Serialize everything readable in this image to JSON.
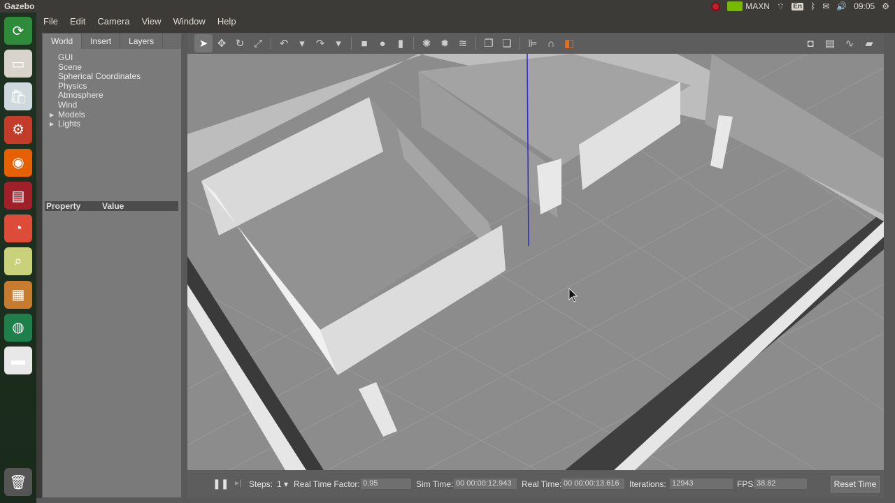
{
  "system": {
    "app_title": "Gazebo",
    "gpu_label": "MAXN",
    "lang": "En",
    "clock": "09:05"
  },
  "menu": [
    "File",
    "Edit",
    "Camera",
    "View",
    "Window",
    "Help"
  ],
  "launcher": [
    {
      "icon": "ubuntu-software-updater-icon",
      "color": "#2e8b3a",
      "glyph": "⟳"
    },
    {
      "icon": "files-icon",
      "color": "#d8d4cc",
      "glyph": "▭"
    },
    {
      "icon": "software-center-icon",
      "color": "#cfd8dc",
      "glyph": "🛍"
    },
    {
      "icon": "system-settings-icon",
      "color": "#c33c2a",
      "glyph": "⚙"
    },
    {
      "icon": "firefox-icon",
      "color": "#e66000",
      "glyph": "◉"
    },
    {
      "icon": "terminal-icon",
      "color": "#a0202a",
      "glyph": "▤"
    },
    {
      "icon": "chromium-icon",
      "color": "#dd4b39",
      "glyph": "◔"
    },
    {
      "icon": "image-viewer-icon",
      "color": "#c9d27a",
      "glyph": "⌕"
    },
    {
      "icon": "package-box-icon",
      "color": "#c77b2e",
      "glyph": "▦"
    },
    {
      "icon": "gazebo-globe-icon",
      "color": "#1e7f4a",
      "glyph": "◍"
    },
    {
      "icon": "drive-icon",
      "color": "#e8e8e8",
      "glyph": "▬"
    }
  ],
  "trash_icon": "trash-icon",
  "panel": {
    "tabs": [
      "World",
      "Insert",
      "Layers"
    ],
    "tree": [
      {
        "label": "GUI",
        "expandable": false
      },
      {
        "label": "Scene",
        "expandable": false
      },
      {
        "label": "Spherical Coordinates",
        "expandable": false
      },
      {
        "label": "Physics",
        "expandable": false
      },
      {
        "label": "Atmosphere",
        "expandable": false
      },
      {
        "label": "Wind",
        "expandable": false
      },
      {
        "label": "Models",
        "expandable": true
      },
      {
        "label": "Lights",
        "expandable": true
      }
    ],
    "property_col": "Property",
    "value_col": "Value"
  },
  "toolbar": {
    "tools": [
      {
        "name": "select-mode-icon",
        "glyph": "➤",
        "selected": true
      },
      {
        "name": "translate-mode-icon",
        "glyph": "✥"
      },
      {
        "name": "rotate-mode-icon",
        "glyph": "↻"
      },
      {
        "name": "scale-mode-icon",
        "glyph": "⤢"
      },
      {
        "sep": true
      },
      {
        "name": "undo-icon",
        "glyph": "↶"
      },
      {
        "name": "undo-dropdown-icon",
        "glyph": "▾"
      },
      {
        "name": "redo-icon",
        "glyph": "↷"
      },
      {
        "name": "redo-dropdown-icon",
        "glyph": "▾"
      },
      {
        "sep": true
      },
      {
        "name": "box-shape-icon",
        "glyph": "■"
      },
      {
        "name": "sphere-shape-icon",
        "glyph": "●"
      },
      {
        "name": "cylinder-shape-icon",
        "glyph": "▮"
      },
      {
        "sep": true
      },
      {
        "name": "point-light-icon",
        "glyph": "✺"
      },
      {
        "name": "spot-light-icon",
        "glyph": "✹"
      },
      {
        "name": "directional-light-icon",
        "glyph": "≋"
      },
      {
        "sep": true
      },
      {
        "name": "copy-icon",
        "glyph": "❐"
      },
      {
        "name": "paste-icon",
        "glyph": "❏"
      },
      {
        "sep": true
      },
      {
        "name": "align-icon",
        "glyph": "⊫"
      },
      {
        "name": "snap-icon",
        "glyph": "∩"
      },
      {
        "name": "change-view-icon",
        "glyph": "◧",
        "accent": "#e07020"
      }
    ],
    "right_tools": [
      {
        "name": "screenshot-icon",
        "glyph": "◘"
      },
      {
        "name": "log-icon",
        "glyph": "▤"
      },
      {
        "name": "plot-icon",
        "glyph": "∿"
      },
      {
        "name": "record-video-icon",
        "glyph": "▰"
      }
    ]
  },
  "status": {
    "steps_label": "Steps:",
    "steps_value": "1",
    "rtf_label": "Real Time Factor:",
    "rtf_value": "0.95",
    "sim_time_label": "Sim Time:",
    "sim_time_value": "00 00:00:12.943",
    "real_time_label": "Real Time:",
    "real_time_value": "00 00:00:13.616",
    "iterations_label": "Iterations:",
    "iterations_value": "12943",
    "fps_label": "FPS:",
    "fps_value": "38.82",
    "reset_label": "Reset Time"
  }
}
